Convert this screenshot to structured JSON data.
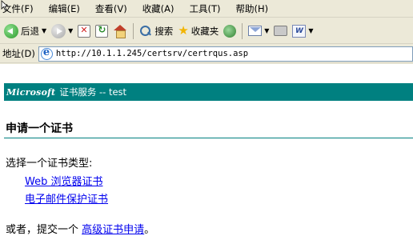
{
  "menu": [
    "文件(F)",
    "编辑(E)",
    "查看(V)",
    "收藏(A)",
    "工具(T)",
    "帮助(H)"
  ],
  "toolbar": {
    "back_label": "后退",
    "search_label": "搜索",
    "favorites_label": "收藏夹"
  },
  "address": {
    "label": "地址(D)",
    "url": "http://10.1.1.245/certsrv/certrqus.asp"
  },
  "banner": {
    "brand": "Microsoft",
    "text": "证书服务  --   test"
  },
  "page": {
    "title": "申请一个证书",
    "prompt": "选择一个证书类型:",
    "links": [
      "Web 浏览器证书",
      "电子邮件保护证书"
    ],
    "alt_prefix": "或者，提交一个 ",
    "alt_link": "高级证书申请",
    "alt_suffix": "。"
  },
  "colors": {
    "banner_bg": "#008080",
    "link": "#0000ee",
    "chrome_bg": "#ece9d8"
  }
}
